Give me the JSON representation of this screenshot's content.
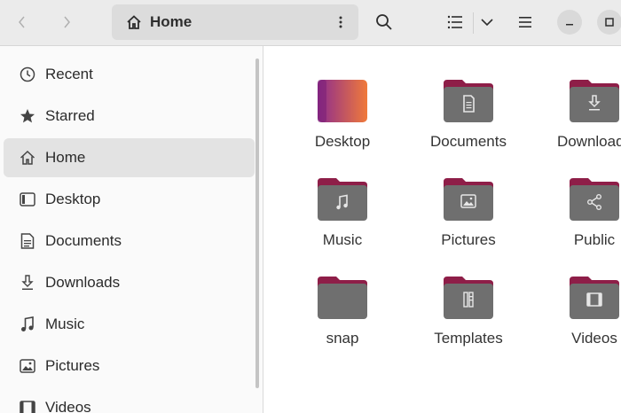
{
  "headerbar": {
    "path_label": "Home",
    "icons": {
      "back": "chevron-left-icon",
      "forward": "chevron-right-icon",
      "path_home": "home-icon",
      "path_menu": "vertical-dots-icon",
      "search": "search-icon",
      "view_list": "list-view-icon",
      "view_options": "chevron-down-icon",
      "menu": "hamburger-icon",
      "minimize": "minimize-icon",
      "maximize": "maximize-icon"
    }
  },
  "sidebar": {
    "items": [
      {
        "label": "Recent",
        "icon": "clock-icon",
        "active": false
      },
      {
        "label": "Starred",
        "icon": "star-icon",
        "active": false
      },
      {
        "label": "Home",
        "icon": "home-icon",
        "active": true
      },
      {
        "label": "Desktop",
        "icon": "desktop-icon",
        "active": false
      },
      {
        "label": "Documents",
        "icon": "document-icon",
        "active": false
      },
      {
        "label": "Downloads",
        "icon": "download-icon",
        "active": false
      },
      {
        "label": "Music",
        "icon": "music-icon",
        "active": false
      },
      {
        "label": "Pictures",
        "icon": "picture-icon",
        "active": false
      },
      {
        "label": "Videos",
        "icon": "video-icon",
        "active": false
      }
    ]
  },
  "content": {
    "items": [
      {
        "label": "Desktop",
        "icon": "desktop-folder-icon"
      },
      {
        "label": "Documents",
        "icon": "documents-folder-icon"
      },
      {
        "label": "Downloads",
        "icon": "downloads-folder-icon"
      },
      {
        "label": "Music",
        "icon": "music-folder-icon"
      },
      {
        "label": "Pictures",
        "icon": "pictures-folder-icon"
      },
      {
        "label": "Public",
        "icon": "public-folder-icon"
      },
      {
        "label": "snap",
        "icon": "folder-icon"
      },
      {
        "label": "Templates",
        "icon": "templates-folder-icon"
      },
      {
        "label": "Videos",
        "icon": "videos-folder-icon"
      }
    ]
  },
  "colors": {
    "folder_tab": "#8e1e48",
    "folder_body": "#6f6f6f",
    "desktop_gradient_start": "#8c2b8f",
    "desktop_gradient_end": "#f07a3a"
  }
}
